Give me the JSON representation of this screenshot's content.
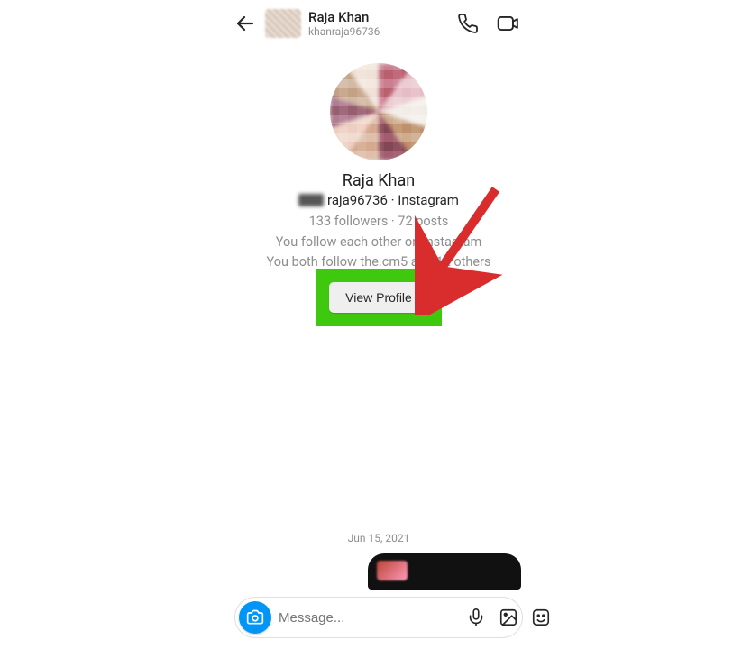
{
  "header": {
    "display_name": "Raja Khan",
    "username_display": "khanraja96736"
  },
  "profile": {
    "name": "Raja Khan",
    "handle_suffix": "raja96736 · Instagram",
    "stats": "133 followers · 72 posts",
    "relation_line1": "You follow each other on Instagram",
    "relation_line2": "You both follow the.cm5 and 12 others",
    "view_profile_label": "View Profile"
  },
  "timestamp": "Jun 15, 2021",
  "composer": {
    "placeholder": "Message..."
  },
  "annotation": {
    "arrow_color": "#d92c2c",
    "highlight_color": "#3fc90e"
  }
}
